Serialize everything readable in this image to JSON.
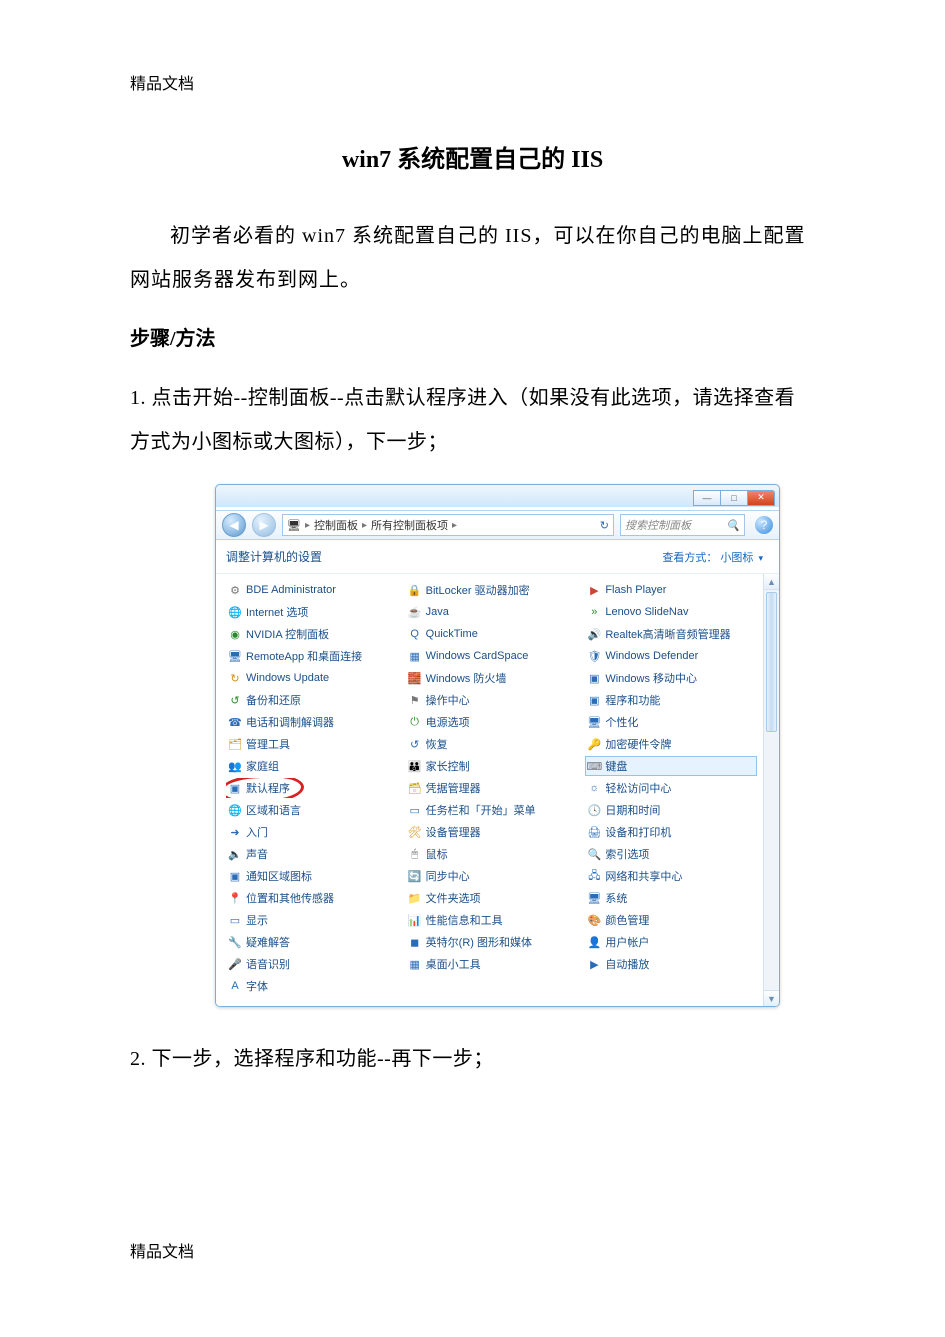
{
  "header": {
    "watermark": "精品文档"
  },
  "document": {
    "title": "win7 系统配置自己的 IIS",
    "intro": "初学者必看的 win7 系统配置自己的 IIS，可以在你自己的电脑上配置网站服务器发布到网上。",
    "steps_heading": "步骤/方法",
    "step1": "1. 点击开始--控制面板--点击默认程序进入（如果没有此选项，请选择查看方式为小图标或大图标），下一步；",
    "step2": "2. 下一步，选择程序和功能--再下一步；"
  },
  "footer": {
    "watermark": "精品文档"
  },
  "control_panel": {
    "window_buttons": {
      "min": "—",
      "max": "□",
      "close": "✕"
    },
    "nav": {
      "back": "◀",
      "forward": "▶"
    },
    "breadcrumb": {
      "root_icon": "🖥",
      "c1": "控制面板",
      "c2": "所有控制面板项",
      "sep": "▸"
    },
    "refresh_glyph": "↻",
    "search_placeholder": "搜索控制面板",
    "search_icon": "🔍",
    "help_glyph": "?",
    "adjust_label": "调整计算机的设置",
    "view_mode_label": "查看方式：",
    "view_mode_value": "小图标",
    "dropdown_glyph": "▾",
    "scroll": {
      "up": "▲",
      "down": "▼"
    },
    "items": [
      {
        "label": "BDE Administrator",
        "icon": "⚙",
        "c": "c-gry"
      },
      {
        "label": "BitLocker 驱动器加密",
        "icon": "🔒",
        "c": "c-gry"
      },
      {
        "label": "Flash Player",
        "icon": "▶",
        "c": "c-red"
      },
      {
        "label": "Internet 选项",
        "icon": "🌐",
        "c": "c-blu"
      },
      {
        "label": "Java",
        "icon": "☕",
        "c": "c-org"
      },
      {
        "label": "Lenovo SlideNav",
        "icon": "»",
        "c": "c-grn"
      },
      {
        "label": "NVIDIA 控制面板",
        "icon": "◉",
        "c": "c-grn"
      },
      {
        "label": "QuickTime",
        "icon": "Q",
        "c": "c-blu"
      },
      {
        "label": "Realtek高清晰音频管理器",
        "icon": "🔊",
        "c": "c-org"
      },
      {
        "label": "RemoteApp 和桌面连接",
        "icon": "🖥",
        "c": "c-blu"
      },
      {
        "label": "Windows CardSpace",
        "icon": "▦",
        "c": "c-blu"
      },
      {
        "label": "Windows Defender",
        "icon": "🛡",
        "c": "c-blu"
      },
      {
        "label": "Windows Update",
        "icon": "↻",
        "c": "c-org"
      },
      {
        "label": "Windows 防火墙",
        "icon": "🧱",
        "c": "c-org"
      },
      {
        "label": "Windows 移动中心",
        "icon": "▣",
        "c": "c-blu"
      },
      {
        "label": "备份和还原",
        "icon": "↺",
        "c": "c-grn"
      },
      {
        "label": "操作中心",
        "icon": "⚑",
        "c": "c-gry"
      },
      {
        "label": "程序和功能",
        "icon": "▣",
        "c": "c-blu"
      },
      {
        "label": "电话和调制解调器",
        "icon": "☎",
        "c": "c-blu"
      },
      {
        "label": "电源选项",
        "icon": "⏻",
        "c": "c-grn"
      },
      {
        "label": "个性化",
        "icon": "🖥",
        "c": "c-blu"
      },
      {
        "label": "管理工具",
        "icon": "🗂",
        "c": "c-org"
      },
      {
        "label": "恢复",
        "icon": "↺",
        "c": "c-blu"
      },
      {
        "label": "加密硬件令牌",
        "icon": "🔑",
        "c": "c-ylw"
      },
      {
        "label": "家庭组",
        "icon": "👥",
        "c": "c-grn"
      },
      {
        "label": "家长控制",
        "icon": "👪",
        "c": "c-org"
      },
      {
        "label": "键盘",
        "icon": "⌨",
        "c": "c-gry",
        "hl": true
      },
      {
        "label": "默认程序",
        "icon": "▣",
        "c": "c-blu",
        "circled": true
      },
      {
        "label": "凭据管理器",
        "icon": "🗃",
        "c": "c-ylw"
      },
      {
        "label": "轻松访问中心",
        "icon": "☼",
        "c": "c-blu"
      },
      {
        "label": "区域和语言",
        "icon": "🌐",
        "c": "c-blu"
      },
      {
        "label": "任务栏和「开始」菜单",
        "icon": "▭",
        "c": "c-blu"
      },
      {
        "label": "日期和时间",
        "icon": "🕓",
        "c": "c-blu"
      },
      {
        "label": "入门",
        "icon": "➜",
        "c": "c-blu"
      },
      {
        "label": "设备管理器",
        "icon": "🛠",
        "c": "c-org"
      },
      {
        "label": "设备和打印机",
        "icon": "🖨",
        "c": "c-blu"
      },
      {
        "label": "声音",
        "icon": "🔈",
        "c": "c-gry"
      },
      {
        "label": "鼠标",
        "icon": "🖱",
        "c": "c-gry"
      },
      {
        "label": "索引选项",
        "icon": "🔍",
        "c": "c-blu"
      },
      {
        "label": "通知区域图标",
        "icon": "▣",
        "c": "c-blu"
      },
      {
        "label": "同步中心",
        "icon": "🔄",
        "c": "c-grn"
      },
      {
        "label": "网络和共享中心",
        "icon": "🖧",
        "c": "c-blu"
      },
      {
        "label": "位置和其他传感器",
        "icon": "📍",
        "c": "c-grn"
      },
      {
        "label": "文件夹选项",
        "icon": "📁",
        "c": "c-ylw"
      },
      {
        "label": "系统",
        "icon": "🖥",
        "c": "c-blu"
      },
      {
        "label": "显示",
        "icon": "▭",
        "c": "c-blu"
      },
      {
        "label": "性能信息和工具",
        "icon": "📊",
        "c": "c-blu"
      },
      {
        "label": "颜色管理",
        "icon": "🎨",
        "c": "c-blu"
      },
      {
        "label": "疑难解答",
        "icon": "🔧",
        "c": "c-blu"
      },
      {
        "label": "英特尔(R) 图形和媒体",
        "icon": "◼",
        "c": "c-blu"
      },
      {
        "label": "用户帐户",
        "icon": "👤",
        "c": "c-grn"
      },
      {
        "label": "语音识别",
        "icon": "🎤",
        "c": "c-blu"
      },
      {
        "label": "桌面小工具",
        "icon": "▦",
        "c": "c-blu"
      },
      {
        "label": "自动播放",
        "icon": "▶",
        "c": "c-blu"
      },
      {
        "label": "字体",
        "icon": "A",
        "c": "c-blu"
      }
    ]
  }
}
